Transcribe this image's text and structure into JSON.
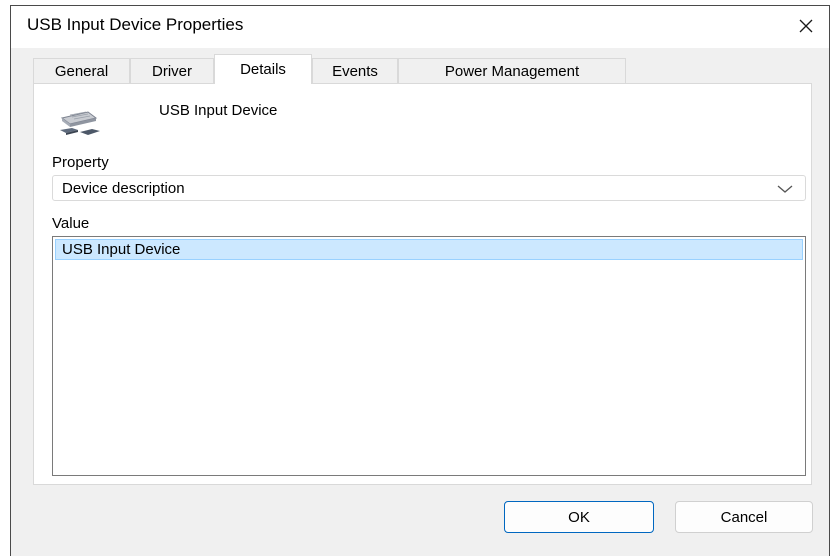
{
  "window": {
    "title": "USB Input Device Properties"
  },
  "tabs": [
    {
      "label": "General"
    },
    {
      "label": "Driver"
    },
    {
      "label": "Details"
    },
    {
      "label": "Events"
    },
    {
      "label": "Power Management"
    }
  ],
  "active_tab": "Details",
  "details": {
    "device_name": "USB Input Device",
    "device_icon": "usb-device-icon",
    "property_label": "Property",
    "property_selected": "Device description",
    "value_label": "Value",
    "values": [
      "USB Input Device"
    ]
  },
  "buttons": {
    "ok": "OK",
    "cancel": "Cancel"
  },
  "colors": {
    "selection_bg": "#cce8ff",
    "selection_border": "#99d1ff",
    "accent": "#0067c0"
  }
}
